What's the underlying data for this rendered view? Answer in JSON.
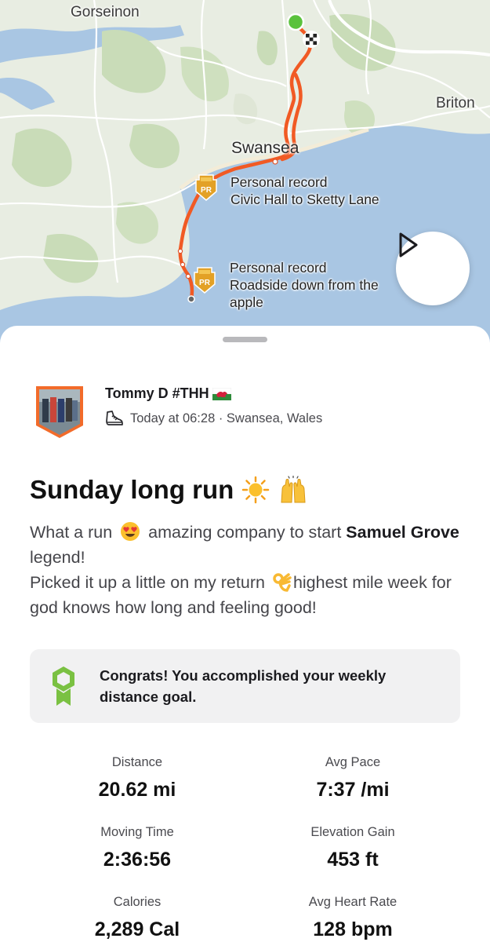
{
  "map": {
    "labels": {
      "gorseinon": "Gorseinon",
      "briton": "Briton",
      "swansea": "Swansea"
    },
    "personal_records": [
      {
        "badge": "PR",
        "title": "Personal record",
        "segment": "Civic Hall to Sketty Lane"
      },
      {
        "badge": "PR",
        "title": "Personal record",
        "segment": "Roadside down from the apple"
      }
    ],
    "route_color": "#f15a24",
    "play_icon": "play-icon"
  },
  "athlete": {
    "name": "Tommy D #THH",
    "flag_icon": "wales-flag-icon",
    "activity_icon": "running-shoe-icon",
    "meta": "Today at 06:28 · Swansea, Wales"
  },
  "activity": {
    "title": "Sunday long run",
    "title_emojis": [
      "sun-emoji",
      "raised-hands-emoji"
    ],
    "description": {
      "p1_a": "What a run",
      "p1_b": "amazing company to start",
      "p1_bold": "Samuel Grove",
      "p1_c": "legend!",
      "p2_a": "Picked it up a little on my return",
      "p2_b": "highest mile week for god knows how long and feeling good!"
    }
  },
  "goal": {
    "text": "Congrats! You accomplished your weekly distance goal.",
    "icon": "goal-badge-icon",
    "accent": "#7ac142"
  },
  "stats": {
    "distance": {
      "label": "Distance",
      "value": "20.62 mi"
    },
    "avg_pace": {
      "label": "Avg Pace",
      "value": "7:37 /mi"
    },
    "moving_time": {
      "label": "Moving Time",
      "value": "2:36:56"
    },
    "elevation_gain": {
      "label": "Elevation Gain",
      "value": "453 ft"
    },
    "calories": {
      "label": "Calories",
      "value": "2,289 Cal"
    },
    "avg_heart_rate": {
      "label": "Avg Heart Rate",
      "value": "128 bpm"
    }
  }
}
